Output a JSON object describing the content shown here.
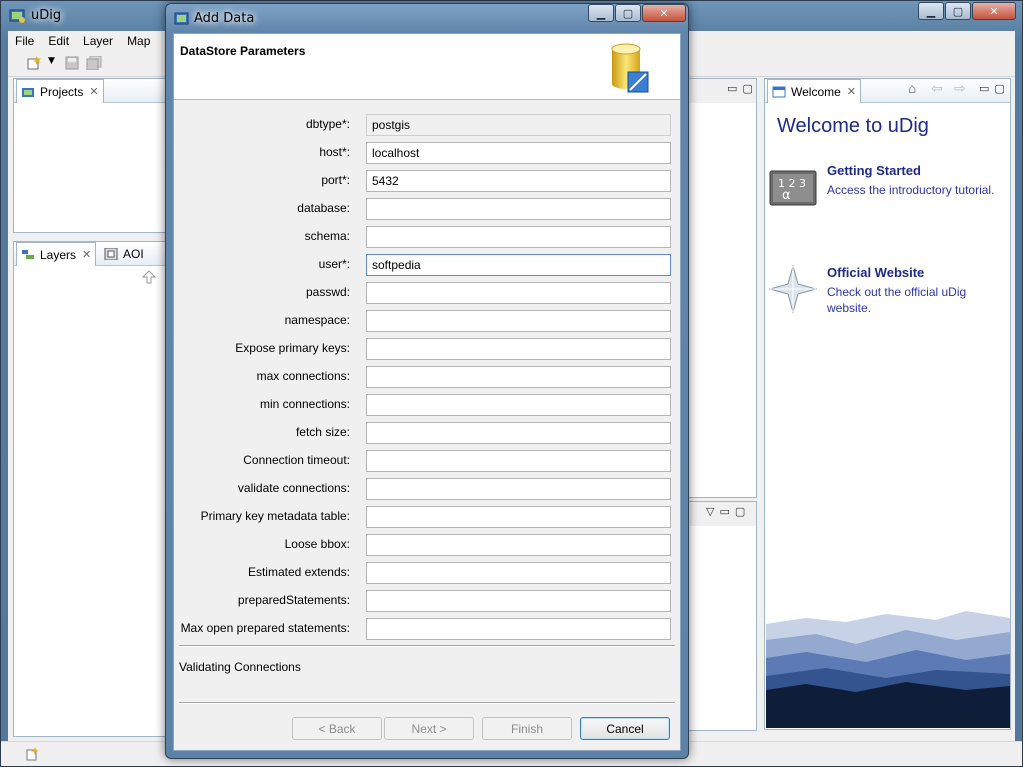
{
  "app": {
    "title": "uDig",
    "menu": [
      "File",
      "Edit",
      "Layer",
      "Map"
    ]
  },
  "views": {
    "projects_tab": "Projects",
    "layers_tab": "Layers",
    "aoi_tab": "AOI",
    "welcome_tab": "Welcome"
  },
  "welcome": {
    "heading": "Welcome to uDig",
    "items": [
      {
        "title": "Getting Started",
        "desc": "Access the introductory tutorial.",
        "icon": "tutorial-icon"
      },
      {
        "title": "Official Website",
        "desc": "Check out the official uDig website.",
        "icon": "compass-star-icon"
      }
    ]
  },
  "dialog": {
    "title": "Add Data",
    "header_title": "DataStore Parameters",
    "fields": [
      {
        "label": "dbtype*:",
        "value": "postgis",
        "readonly": true
      },
      {
        "label": "host*:",
        "value": "localhost"
      },
      {
        "label": "port*:",
        "value": "5432"
      },
      {
        "label": "database:",
        "value": ""
      },
      {
        "label": "schema:",
        "value": ""
      },
      {
        "label": "user*:",
        "value": "softpedia",
        "focused": true
      },
      {
        "label": "passwd:",
        "value": ""
      },
      {
        "label": "namespace:",
        "value": ""
      },
      {
        "label": "Expose primary keys:",
        "value": ""
      },
      {
        "label": "max connections:",
        "value": ""
      },
      {
        "label": "min connections:",
        "value": ""
      },
      {
        "label": "fetch size:",
        "value": ""
      },
      {
        "label": "Connection timeout:",
        "value": ""
      },
      {
        "label": "validate connections:",
        "value": ""
      },
      {
        "label": "Primary key metadata table:",
        "value": ""
      },
      {
        "label": "Loose bbox:",
        "value": ""
      },
      {
        "label": "Estimated extends:",
        "value": ""
      },
      {
        "label": "preparedStatements:",
        "value": ""
      },
      {
        "label": "Max open prepared statements:",
        "value": ""
      }
    ],
    "status": "Validating Connections",
    "buttons": {
      "back": "< Back",
      "next": "Next >",
      "finish": "Finish",
      "cancel": "Cancel"
    }
  },
  "colors": {
    "link": "#1e2a8c",
    "frame": "#5c82a7"
  }
}
